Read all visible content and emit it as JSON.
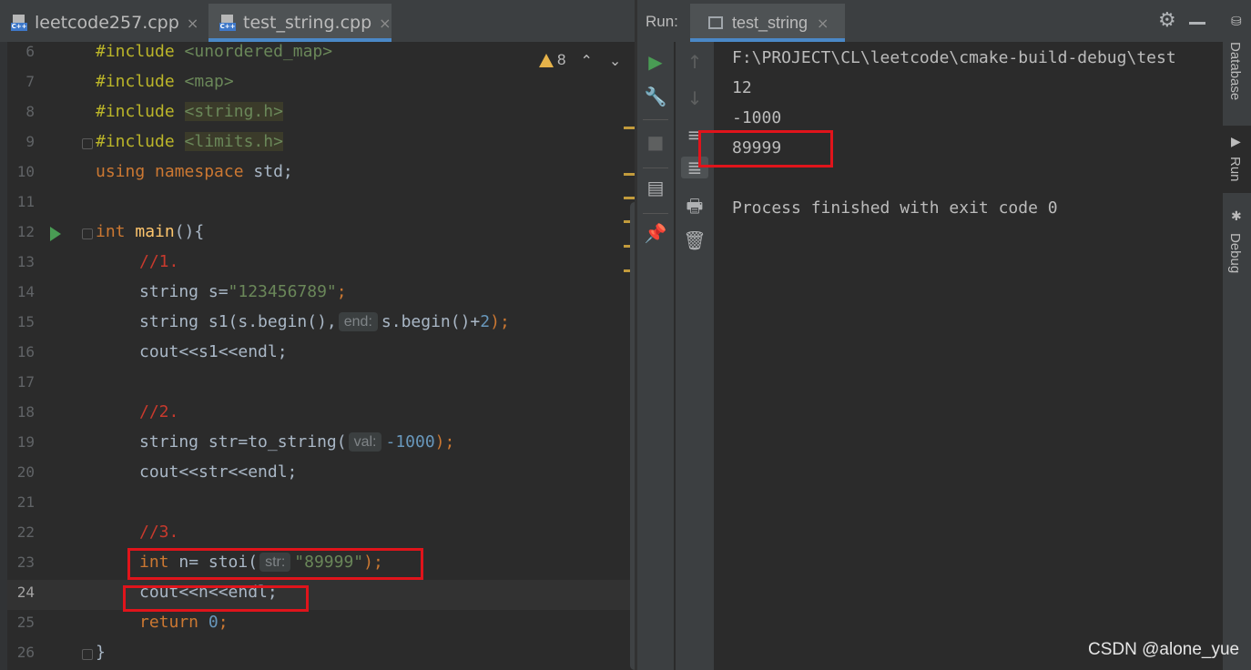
{
  "editor": {
    "tabs": [
      {
        "label": "leetcode257.cpp",
        "close": "×",
        "icon": "cpp-file-icon",
        "active": false
      },
      {
        "label": "test_string.cpp",
        "close": "×",
        "icon": "cpp-file-icon",
        "active": true
      }
    ],
    "warnings": {
      "count": "8",
      "up": "⌃",
      "down": "⌄"
    },
    "lines": [
      {
        "num": "6"
      },
      {
        "num": "7"
      },
      {
        "num": "8"
      },
      {
        "num": "9"
      },
      {
        "num": "10"
      },
      {
        "num": "11"
      },
      {
        "num": "12"
      },
      {
        "num": "13"
      },
      {
        "num": "14"
      },
      {
        "num": "15"
      },
      {
        "num": "16"
      },
      {
        "num": "17"
      },
      {
        "num": "18"
      },
      {
        "num": "19"
      },
      {
        "num": "20"
      },
      {
        "num": "21"
      },
      {
        "num": "22"
      },
      {
        "num": "23"
      },
      {
        "num": "24"
      },
      {
        "num": "25"
      },
      {
        "num": "26"
      }
    ],
    "code": {
      "l6_a": "#include",
      "l6_b": "<unordered_map>",
      "l7_a": "#include",
      "l7_b": "<map>",
      "l8_a": "#include",
      "l8_b": "<string.h>",
      "l9_a": "#include",
      "l9_b": "<limits.h>",
      "l10_a": "using namespace",
      "l10_b": " std;",
      "l12_a": "int",
      "l12_b": " main",
      "l12_c": "(){",
      "l13": "//1.",
      "l14_a": "string s=",
      "l14_b": "\"123456789\"",
      "l14_c": ";",
      "l15_a": "string s1(s.begin(),",
      "l15_hint": "end:",
      "l15_b": "s.begin()+",
      "l15_c": "2",
      "l15_d": ");",
      "l16": "cout<<s1<<endl;",
      "l18": "//2.",
      "l19_a": "string str=to_string(",
      "l19_hint": "val:",
      "l19_b": "-1000",
      "l19_c": ");",
      "l20": "cout<<str<<endl;",
      "l22": "//3.",
      "l23_a": "int",
      "l23_b": " n= stoi(",
      "l23_hint": "str:",
      "l23_c": "\"89999\"",
      "l23_d": ");",
      "l24": "cout<<n<<endl;",
      "l25_a": "return",
      "l25_b": "0",
      "l25_c": ";",
      "l26": "}"
    }
  },
  "run_panel": {
    "label": "Run:",
    "tab": {
      "label": "test_string",
      "close": "×"
    },
    "output": [
      "F:\\PROJECT\\CL\\leetcode\\cmake-build-debug\\test",
      "12",
      "-1000",
      "89999",
      "",
      "Process finished with exit code 0"
    ]
  },
  "right_strip": {
    "items": [
      {
        "label": "Database",
        "icon": "database-icon",
        "active": false
      },
      {
        "label": "Run",
        "icon": "run-icon",
        "active": true
      },
      {
        "label": "Debug",
        "icon": "bug-icon",
        "active": false
      }
    ]
  },
  "watermark": "CSDN @alone_yue"
}
